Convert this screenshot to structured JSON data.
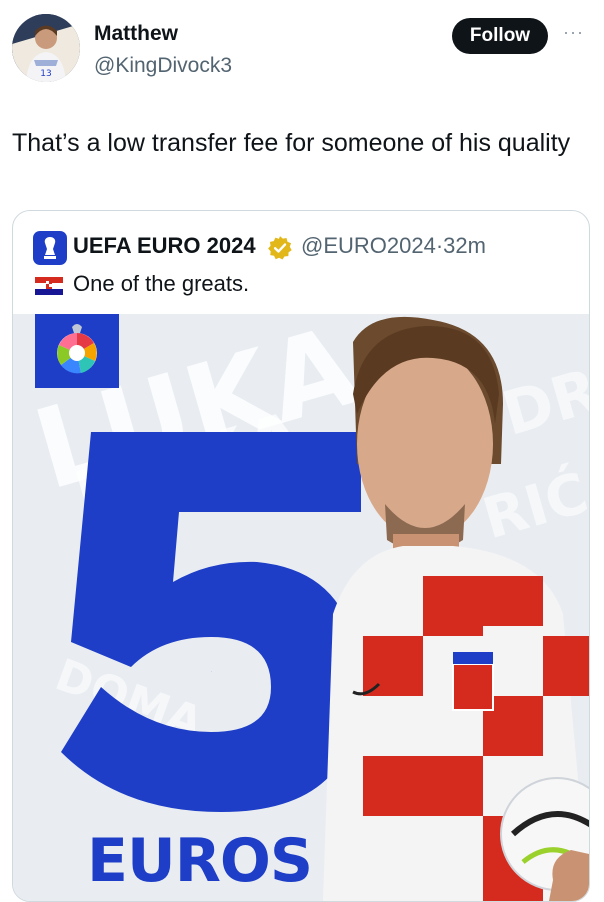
{
  "author": {
    "display_name": "Matthew",
    "handle": "@KingDivock3",
    "avatar_icon": "profile-photo"
  },
  "follow_label": "Follow",
  "more_label": "···",
  "tweet_text": "That’s a low transfer fee for someone of his quality",
  "quoted": {
    "display_name": "UEFA EURO 2024",
    "handle": "@EURO2024",
    "separator": "·",
    "time": "32m",
    "text": "One of the greats.",
    "verified_color": "#e2b719",
    "flag_icon": "croatia-flag-icon",
    "media": {
      "big_number": "5",
      "bottom_text": "EUROS",
      "background_words": [
        "LUKA",
        "LUKA",
        "MODRIĆ",
        "RIĆ",
        "DOMA"
      ],
      "brand_color": "#1e3ec7"
    }
  }
}
